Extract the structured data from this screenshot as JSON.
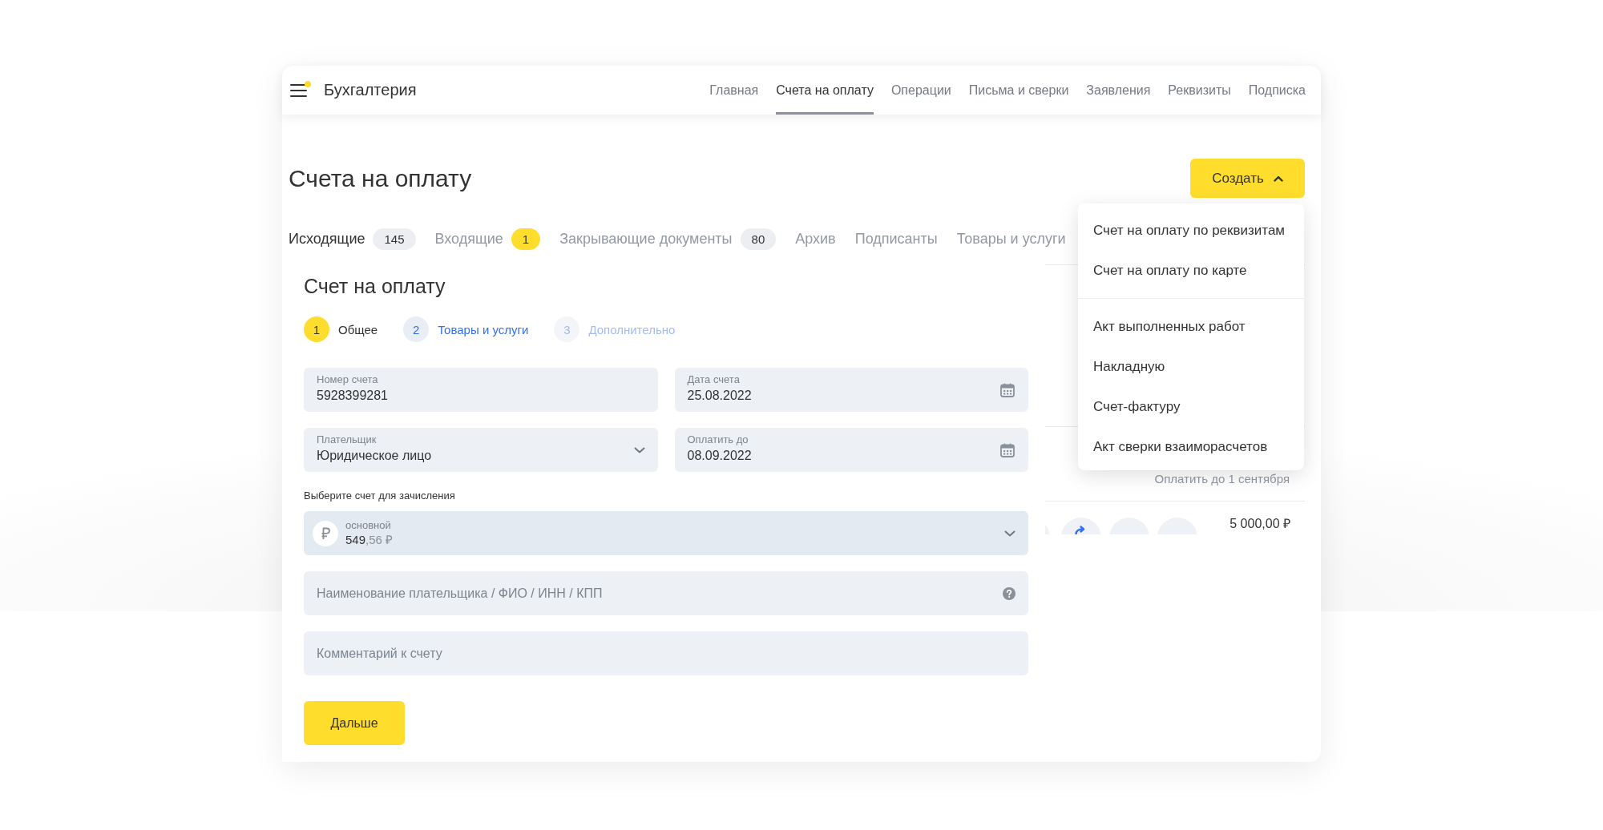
{
  "header": {
    "app_title": "Бухгалтерия",
    "nav": [
      {
        "label": "Главная",
        "selected": false
      },
      {
        "label": "Счета на оплату",
        "selected": true
      },
      {
        "label": "Операции",
        "selected": false
      },
      {
        "label": "Письма и сверки",
        "selected": false
      },
      {
        "label": "Заявления",
        "selected": false
      },
      {
        "label": "Реквизиты",
        "selected": false
      },
      {
        "label": "Подписка",
        "selected": false
      }
    ]
  },
  "page": {
    "title": "Счета на оплату",
    "create_button": {
      "label": "Создать",
      "expanded": true
    },
    "create_menu": {
      "sections": [
        {
          "items": [
            "Счет на оплату по реквизитам",
            "Счет на оплату по карте"
          ]
        },
        {
          "items": [
            "Акт выполненных работ",
            "Накладную",
            "Счет-фактуру",
            "Акт сверки взаиморасчетов"
          ]
        }
      ]
    }
  },
  "tabs": [
    {
      "label": "Исходящие",
      "selected": true,
      "badge": {
        "text": "145",
        "highlighted": false
      }
    },
    {
      "label": "Входящие",
      "selected": false,
      "badge": {
        "text": "1",
        "highlighted": true
      }
    },
    {
      "label": "Закрывающие документы",
      "selected": false,
      "badge": {
        "text": "80",
        "highlighted": false
      }
    },
    {
      "label": "Архив",
      "selected": false
    },
    {
      "label": "Подписанты",
      "selected": false
    },
    {
      "label": "Товары и услуги",
      "selected": false
    }
  ],
  "invoice_form": {
    "title": "Счет на оплату",
    "steps": [
      {
        "number": "1",
        "label": "Общее",
        "selected": true,
        "disabled": false
      },
      {
        "number": "2",
        "label": "Товары и услуги",
        "selected": false,
        "disabled": false
      },
      {
        "number": "3",
        "label": "Дополнительно",
        "selected": false,
        "disabled": true
      }
    ],
    "fields": [
      {
        "kind": "text",
        "label": "Номер счета",
        "value": "5928399281"
      },
      {
        "kind": "date",
        "label": "Дата счета",
        "value": "25.08.2022"
      },
      {
        "kind": "select",
        "label": "Плательщик",
        "value": "Юридическое лицо"
      },
      {
        "kind": "date",
        "label": "Оплатить до",
        "value": "08.09.2022"
      }
    ],
    "account": {
      "label": "Выберите счет для зачисления",
      "name": "основной",
      "amount_main": "549",
      "amount_fraction": ",56 ₽"
    },
    "payer_field": {
      "placeholder": "Наименование плательщика / ФИО / ИНН / КПП"
    },
    "comment_field": {
      "placeholder": "Комментарий к счету"
    },
    "next_button": "Дальше"
  },
  "invoice_list": {
    "due_text": "Оплатить до 1 сентября",
    "amount": "5 000,00 ₽"
  }
}
